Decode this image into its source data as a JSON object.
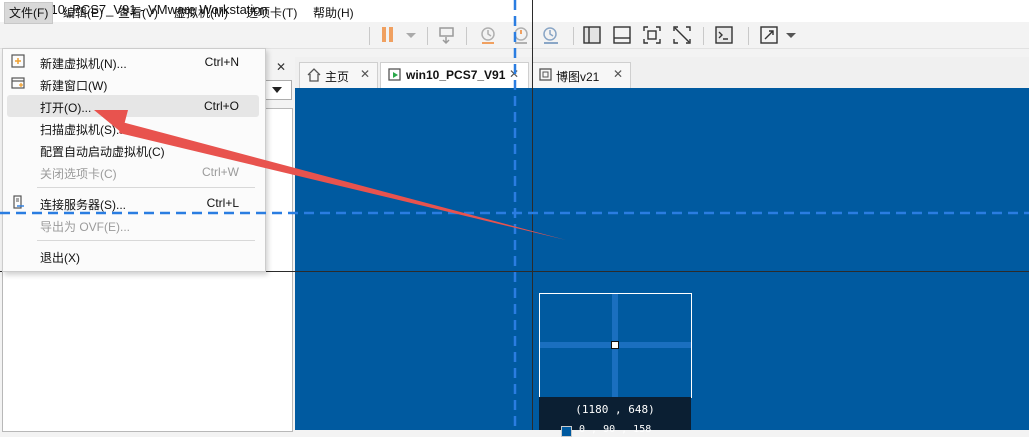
{
  "window": {
    "title": "win10_PCS7_V91 - VMware Workstation"
  },
  "menubar": {
    "items": [
      {
        "label": "文件(F)",
        "active": true
      },
      {
        "label": "编辑(E)"
      },
      {
        "label": "查看(V)"
      },
      {
        "label": "虚拟机(M)"
      },
      {
        "label": "选项卡(T)"
      },
      {
        "label": "帮助(H)"
      }
    ]
  },
  "file_menu": {
    "items": [
      {
        "label": "新建虚拟机(N)...",
        "shortcut": "Ctrl+N",
        "icon": "new-vm-icon",
        "disabled": false
      },
      {
        "label": "新建窗口(W)",
        "shortcut": "",
        "icon": "new-window-icon",
        "disabled": false
      },
      {
        "label": "打开(O)...",
        "shortcut": "Ctrl+O",
        "icon": "",
        "disabled": false,
        "highlighted": true
      },
      {
        "label": "扫描虚拟机(S)...",
        "shortcut": "",
        "icon": "",
        "disabled": false
      },
      {
        "label": "配置自动启动虚拟机(C)",
        "shortcut": "",
        "icon": "",
        "disabled": false
      },
      {
        "label": "关闭选项卡(C)",
        "shortcut": "Ctrl+W",
        "icon": "",
        "disabled": true
      },
      {
        "label": "连接服务器(S)...",
        "shortcut": "Ctrl+L",
        "icon": "connect-server-icon",
        "disabled": false
      },
      {
        "label": "导出为 OVF(E)...",
        "shortcut": "",
        "icon": "",
        "disabled": true
      },
      {
        "label": "退出(X)",
        "shortcut": "",
        "icon": "",
        "disabled": false
      }
    ]
  },
  "tabs": [
    {
      "label": "主页",
      "icon": "home-icon"
    },
    {
      "label": "win10_PCS7_V91",
      "icon": "vm-running-icon",
      "active": true
    },
    {
      "label": "博图v21",
      "icon": "vm-icon"
    }
  ],
  "overlay": {
    "coordinates": "(1180 , 648)",
    "partial_readout": "0 , 90 , 158"
  },
  "colors": {
    "vm_background": "#005aa0",
    "annotation_arrow": "#e8534e",
    "guide_line": "#2a7de1"
  }
}
